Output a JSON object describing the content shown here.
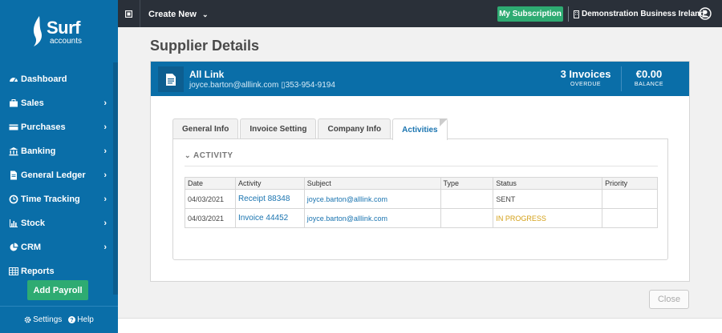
{
  "brand": {
    "name": "Surf",
    "sub": "accounts"
  },
  "sidebar": {
    "items": [
      {
        "label": "Dashboard",
        "icon": "dashboard-icon",
        "chevron": false
      },
      {
        "label": "Sales",
        "icon": "briefcase-icon",
        "chevron": true
      },
      {
        "label": "Purchases",
        "icon": "card-icon",
        "chevron": true
      },
      {
        "label": "Banking",
        "icon": "bank-icon",
        "chevron": true
      },
      {
        "label": "General Ledger",
        "icon": "document-icon",
        "chevron": true
      },
      {
        "label": "Time Tracking",
        "icon": "clock-icon",
        "chevron": true
      },
      {
        "label": "Stock",
        "icon": "bar-chart-icon",
        "chevron": true
      },
      {
        "label": "CRM",
        "icon": "pie-chart-icon",
        "chevron": true
      },
      {
        "label": "Reports",
        "icon": "table-icon",
        "chevron": false
      }
    ],
    "payroll_button": "Add Payroll",
    "settings_label": "Settings",
    "help_label": "Help"
  },
  "topbar": {
    "create_new": "Create New",
    "subscription": "My Subscription",
    "business": "Demonstration Business Ireland"
  },
  "page": {
    "title": "Supplier Details"
  },
  "supplier": {
    "name": "All Link",
    "email": "joyce.barton@alllink.com",
    "phone": "353-954-9194",
    "invoices_value": "3 Invoices",
    "invoices_label": "OVERDUE",
    "balance_value": "€0.00",
    "balance_label": "BALANCE"
  },
  "tabs": [
    {
      "label": "General Info",
      "active": false
    },
    {
      "label": "Invoice Setting",
      "active": false
    },
    {
      "label": "Company Info",
      "active": false
    },
    {
      "label": "Activities",
      "active": true
    }
  ],
  "activity": {
    "heading": "ACTIVITY",
    "columns": [
      "Date",
      "Activity",
      "Subject",
      "Type",
      "Status",
      "Priority"
    ],
    "rows": [
      {
        "date": "04/03/2021",
        "activity": "Receipt 88348",
        "subject": "joyce.barton@alllink.com",
        "type": "",
        "status": "SENT",
        "priority": ""
      },
      {
        "date": "04/03/2021",
        "activity": "Invoice 44452",
        "subject": "joyce.barton@alllink.com",
        "type": "",
        "status": "IN PROGRESS",
        "priority": ""
      }
    ]
  },
  "footer": {
    "close_label": "Close"
  },
  "colors": {
    "primary": "#0a6ea8",
    "topbar": "#2a3039",
    "green": "#2eab72",
    "status_sent": "#444444",
    "status_progress": "#d4a017"
  }
}
